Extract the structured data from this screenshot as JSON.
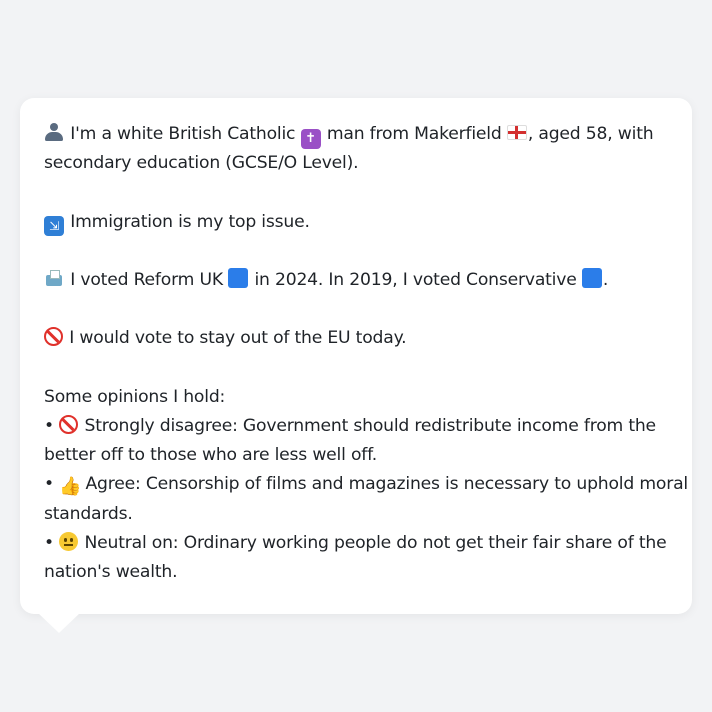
{
  "intro": {
    "p1": "I'm a white British Catholic",
    "p2": "man from Makerfield",
    "p3": ", aged 58, with",
    "line2": "secondary education (GCSE/O Level)."
  },
  "issue": {
    "text": "Immigration is my top issue."
  },
  "vote": {
    "p1": "I voted Reform UK",
    "p2": "in 2024. In 2019, I voted Conservative",
    "p3": "."
  },
  "eu": {
    "text": "I would vote to stay out of the EU today."
  },
  "opinions": {
    "heading": "Some opinions I hold:",
    "bullet": "•",
    "items": [
      {
        "icon": "no-entry-icon",
        "line1": "Strongly disagree: Government should redistribute income from the",
        "line2": "better off to those who are less well off."
      },
      {
        "icon": "thumbs-up-icon",
        "line1": "Agree: Censorship of films and magazines is necessary to uphold moral",
        "line2": "standards."
      },
      {
        "icon": "neutral-face-icon",
        "line1": "Neutral on: Ordinary working people do not get their fair share of the",
        "line2": "nation's wealth."
      }
    ]
  },
  "icons": {
    "cross_glyph": "✝",
    "migration_glyph": "⇲",
    "thumbs_glyph": "👍"
  },
  "colors": {
    "background": "#f2f3f5",
    "card": "#ffffff",
    "text": "#1f2328",
    "reform_square": "#2b7de9",
    "conservative_square": "#2b7de9"
  }
}
